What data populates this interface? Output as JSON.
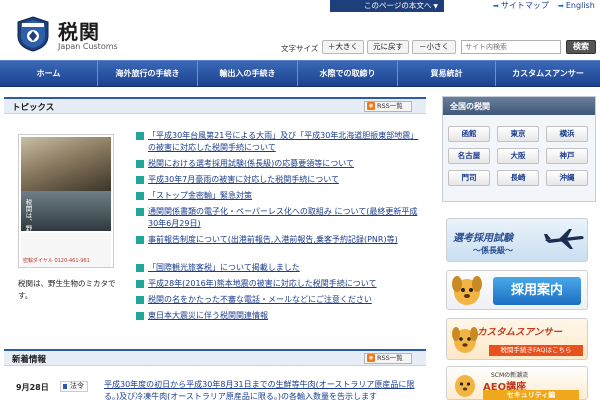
{
  "top_bar": {
    "skip_link": "このページの本文へ",
    "sitemap": "サイトマップ",
    "english": "English"
  },
  "header": {
    "title": "税関",
    "subtitle": "Japan Customs",
    "font_size_label": "文字サイズ",
    "font_large": "大きく",
    "font_reset": "元に戻す",
    "font_small": "小さく",
    "search_placeholder": "サイト内検索",
    "search_button": "検索"
  },
  "nav": {
    "items": [
      {
        "label": "ホーム"
      },
      {
        "label": "海外旅行の手続き"
      },
      {
        "label": "輸出入の手続き"
      },
      {
        "label": "水際での取締り"
      },
      {
        "label": "貿易統計"
      },
      {
        "label": "カスタムスアンサー"
      }
    ]
  },
  "topics": {
    "title": "トピックス",
    "rss": "RSS一覧",
    "poster_text": "税関は、野生生物のミカタです。",
    "poster_phone": "密輸ダイヤル 0120-461-961",
    "poster_caption": "税関は、野生生物のミカタです。",
    "items": [
      {
        "text": "「平成30年台風第21号による大雨」及び「平成30年北海道胆振東部地震」の被害に対応した税関手続について"
      },
      {
        "text": "税関における選考採用試験(係長級)の応募要領等について"
      },
      {
        "text": "平成30年7月豪雨の被害に対応した税関手続について"
      },
      {
        "text": "「ストップ金密輸」緊急対策"
      },
      {
        "text": "通関関係書類の電子化・ペーパーレス化への取組み について(最終更新平成30年6月29日)"
      },
      {
        "text": "事前報告制度について(出港前報告,入港前報告,乗客予約記録(PNR)等)"
      },
      {
        "text": "「国際観光旅客税」について掲載しました"
      },
      {
        "text": "平成28年(2016年)熊本地震の被害に対応した税関手続について"
      },
      {
        "text": "税関の名をかたった不審な電話・メールなどにご注意ください"
      },
      {
        "text": "東日本大震災に伴う税関関連情報"
      }
    ]
  },
  "news": {
    "title": "新着情報",
    "rss": "RSS一覧",
    "date": "9月28日",
    "category": "法令",
    "text": "平成30年度の初日から平成30年8月31日までの生鮮等牛肉(オーストラリア原産品に限る。)及び冷凍牛肉(オーストラリア原産品に限る。)の各輸入数量を告示します"
  },
  "offices": {
    "title": "全国の税関",
    "items": [
      {
        "label": "函館"
      },
      {
        "label": "東京"
      },
      {
        "label": "横浜"
      },
      {
        "label": "名古屋"
      },
      {
        "label": "大阪"
      },
      {
        "label": "神戸"
      },
      {
        "label": "門司"
      },
      {
        "label": "長崎"
      },
      {
        "label": "沖縄"
      }
    ]
  },
  "banners": {
    "recruit_exam_title": "選考採用試験",
    "recruit_exam_sub": "〜係長級〜",
    "recruit_info": "採用案内",
    "customs_answer_title": "カスタムスアンサー",
    "customs_answer_sub": "税関手続きFAQはこちら",
    "aeo_small": "SCMの新潮流",
    "aeo_title": "AEO講座",
    "aeo_sub": "セキュリティ編"
  },
  "colors": {
    "nav_blue": "#1c428f",
    "link_blue": "#1a3d8f",
    "bullet_teal": "#1fa89a",
    "rss_orange": "#f07a1a"
  }
}
